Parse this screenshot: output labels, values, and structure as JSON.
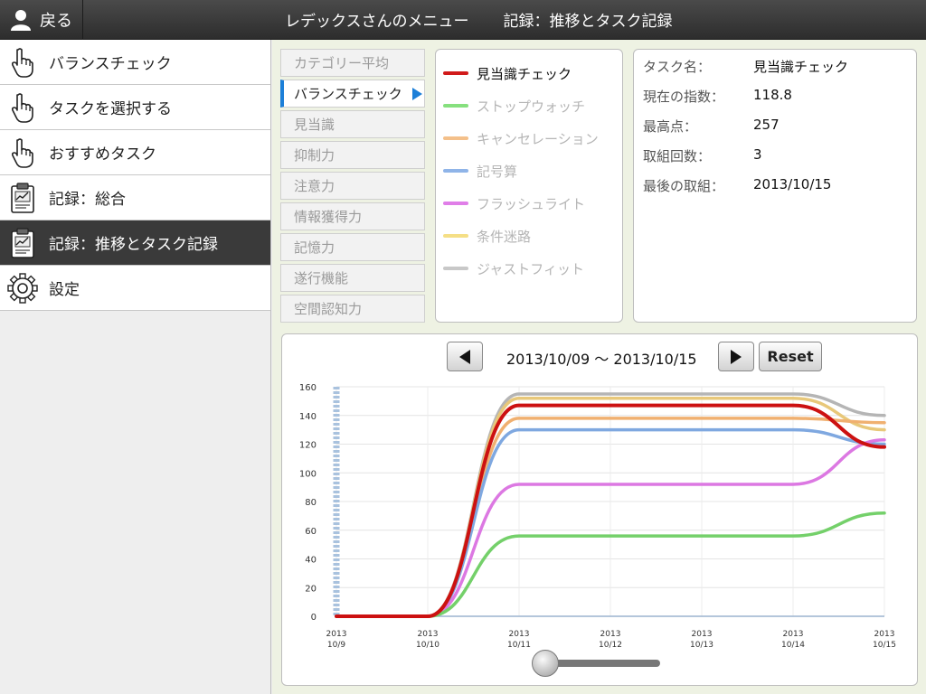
{
  "header": {
    "back_label": "戻る",
    "title": "レデックスさんのメニュー",
    "subtitle": "記録：推移とタスク記録"
  },
  "sidebar": {
    "items": [
      {
        "label": "バランスチェック",
        "icon": "pointing-hand-icon",
        "active": false
      },
      {
        "label": "タスクを選択する",
        "icon": "pointing-hand-icon",
        "active": false
      },
      {
        "label": "おすすめタスク",
        "icon": "pointing-hand-icon",
        "active": false
      },
      {
        "label": "記録：総合",
        "icon": "clipboard-chart-icon",
        "active": false
      },
      {
        "label": "記録：推移とタスク記録",
        "icon": "clipboard-chart-icon",
        "active": true
      },
      {
        "label": "設定",
        "icon": "gear-icon",
        "active": false
      }
    ]
  },
  "categories": [
    {
      "label": "カテゴリー平均",
      "active": false
    },
    {
      "label": "バランスチェック",
      "active": true
    },
    {
      "label": "見当識",
      "active": false
    },
    {
      "label": "抑制力",
      "active": false
    },
    {
      "label": "注意力",
      "active": false
    },
    {
      "label": "情報獲得力",
      "active": false
    },
    {
      "label": "記憶力",
      "active": false
    },
    {
      "label": "遂行機能",
      "active": false
    },
    {
      "label": "空間認知力",
      "active": false
    }
  ],
  "legend": [
    {
      "label": "見当識チェック",
      "color": "#d11a1a",
      "active": true
    },
    {
      "label": "ストップウォッチ",
      "color": "#86e07e",
      "active": false
    },
    {
      "label": "キャンセレーション",
      "color": "#f4c08a",
      "active": false
    },
    {
      "label": "記号算",
      "color": "#8fb4e8",
      "active": false
    },
    {
      "label": "フラッシュライト",
      "color": "#e07ee8",
      "active": false
    },
    {
      "label": "条件迷路",
      "color": "#f5df86",
      "active": false
    },
    {
      "label": "ジャストフィット",
      "color": "#c8c8c8",
      "active": false
    }
  ],
  "task_info": [
    {
      "key": "タスク名：",
      "value": "見当識チェック"
    },
    {
      "key": "現在の指数：",
      "value": "118.8"
    },
    {
      "key": "最高点：",
      "value": "257"
    },
    {
      "key": "取組回数：",
      "value": "3"
    },
    {
      "key": "最後の取組：",
      "value": "2013/10/15"
    }
  ],
  "chart_controls": {
    "date_range": "2013/10/09 ～ 2013/10/15",
    "reset_label": "Reset",
    "slider_value": 0
  },
  "chart_data": {
    "type": "line",
    "ylim": [
      0,
      160
    ],
    "yticks": [
      0,
      20,
      40,
      60,
      80,
      100,
      120,
      140,
      160
    ],
    "categories": [
      "2013\n10/9",
      "2013\n10/10",
      "2013\n10/11",
      "2013\n10/12",
      "2013\n10/13",
      "2013\n10/14",
      "2013\n10/15"
    ],
    "series": [
      {
        "name": "ジャストフィット",
        "color": "#b5b5b5",
        "values": [
          0,
          0,
          155,
          155,
          155,
          155,
          140
        ]
      },
      {
        "name": "条件迷路",
        "color": "#e8c87a",
        "values": [
          0,
          0,
          152,
          152,
          152,
          152,
          130
        ]
      },
      {
        "name": "キャンセレーション",
        "color": "#f0b070",
        "values": [
          0,
          0,
          138,
          138,
          138,
          138,
          135
        ]
      },
      {
        "name": "記号算",
        "color": "#7fa8e0",
        "values": [
          0,
          0,
          130,
          130,
          130,
          130,
          120
        ]
      },
      {
        "name": "フラッシュライト",
        "color": "#dc78e2",
        "values": [
          0,
          0,
          92,
          92,
          92,
          92,
          123
        ]
      },
      {
        "name": "ストップウォッチ",
        "color": "#74d06a",
        "values": [
          0,
          0,
          56,
          56,
          56,
          56,
          72
        ]
      },
      {
        "name": "見当識チェック",
        "color": "#cc1111",
        "values": [
          0,
          0,
          147,
          147,
          147,
          147,
          118
        ]
      }
    ]
  }
}
